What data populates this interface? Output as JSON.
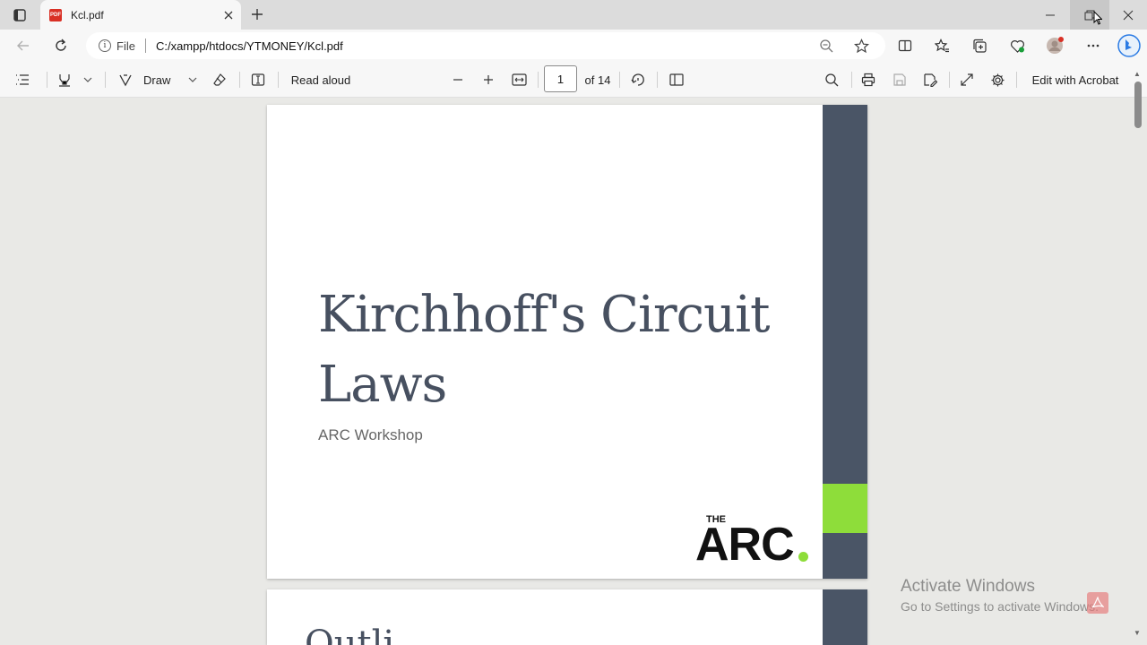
{
  "browser": {
    "tab": {
      "title": "Kcl.pdf",
      "icon": "pdf-file-icon",
      "pdf_badge": "PDF"
    },
    "address": {
      "scheme": "File",
      "url": "C:/xampp/htdocs/YTMONEY/Kcl.pdf"
    }
  },
  "pdf_toolbar": {
    "draw_label": "Draw",
    "read_aloud_label": "Read aloud",
    "page_number": "1",
    "page_total": "of 14",
    "edit_acrobat_label": "Edit with Acrobat"
  },
  "document": {
    "page1": {
      "title": "Kirchhoff's Circuit Laws",
      "subtitle": "ARC Workshop",
      "logo_small": "THE",
      "logo_big": "ARC"
    },
    "page2": {
      "heading_partial": "Outli"
    }
  },
  "watermark": {
    "line1": "Activate Windows",
    "line2": "Go to Settings to activate Windows."
  },
  "colors": {
    "accent_band": "#4a5566",
    "accent_green": "#8edd3a",
    "title_color": "#475060"
  }
}
